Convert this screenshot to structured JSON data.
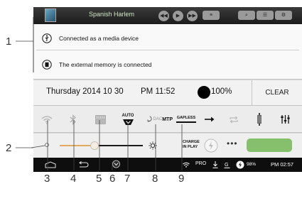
{
  "player": {
    "song_title": "Spanish Harlem"
  },
  "notifications": [
    {
      "text": "Connected as a media device",
      "icon": "usb-icon"
    },
    {
      "text": "The external memory is connected",
      "icon": "sd-card-icon"
    }
  ],
  "status_row": {
    "date": "Thursday 2014 10 30",
    "time": "PM 11:52",
    "battery": "100%",
    "clear_label": "CLEAR"
  },
  "quick_settings": {
    "auto_label": "AUTO",
    "dac_label": "DAC",
    "mtp_label": "MTP",
    "gapless_label": "GAPLESS",
    "icons": [
      "wifi-icon",
      "bluetooth-icon",
      "sd-card-icon",
      "auto-eq-icon",
      "mtp-icon",
      "gapless-icon",
      "arrow-right-icon",
      "repeat-icon",
      "usb-dac-icon",
      "equalizer-icon"
    ]
  },
  "brightness": {
    "level": 0.42,
    "charge_line1": "CHARGE",
    "charge_line2": "IN PLAY",
    "more_label": "•••"
  },
  "status_bar": {
    "pro": "PRO",
    "battery": "98%",
    "time": "PM 02:57"
  },
  "callouts": {
    "c1": "1",
    "c2": "2",
    "c3": "3",
    "c4": "4",
    "c5": "5",
    "c6": "6",
    "c7": "7",
    "c8": "8",
    "c9": "9"
  },
  "colors": {
    "green_button": "#86c06c",
    "slider_fill": "#e4a960"
  }
}
